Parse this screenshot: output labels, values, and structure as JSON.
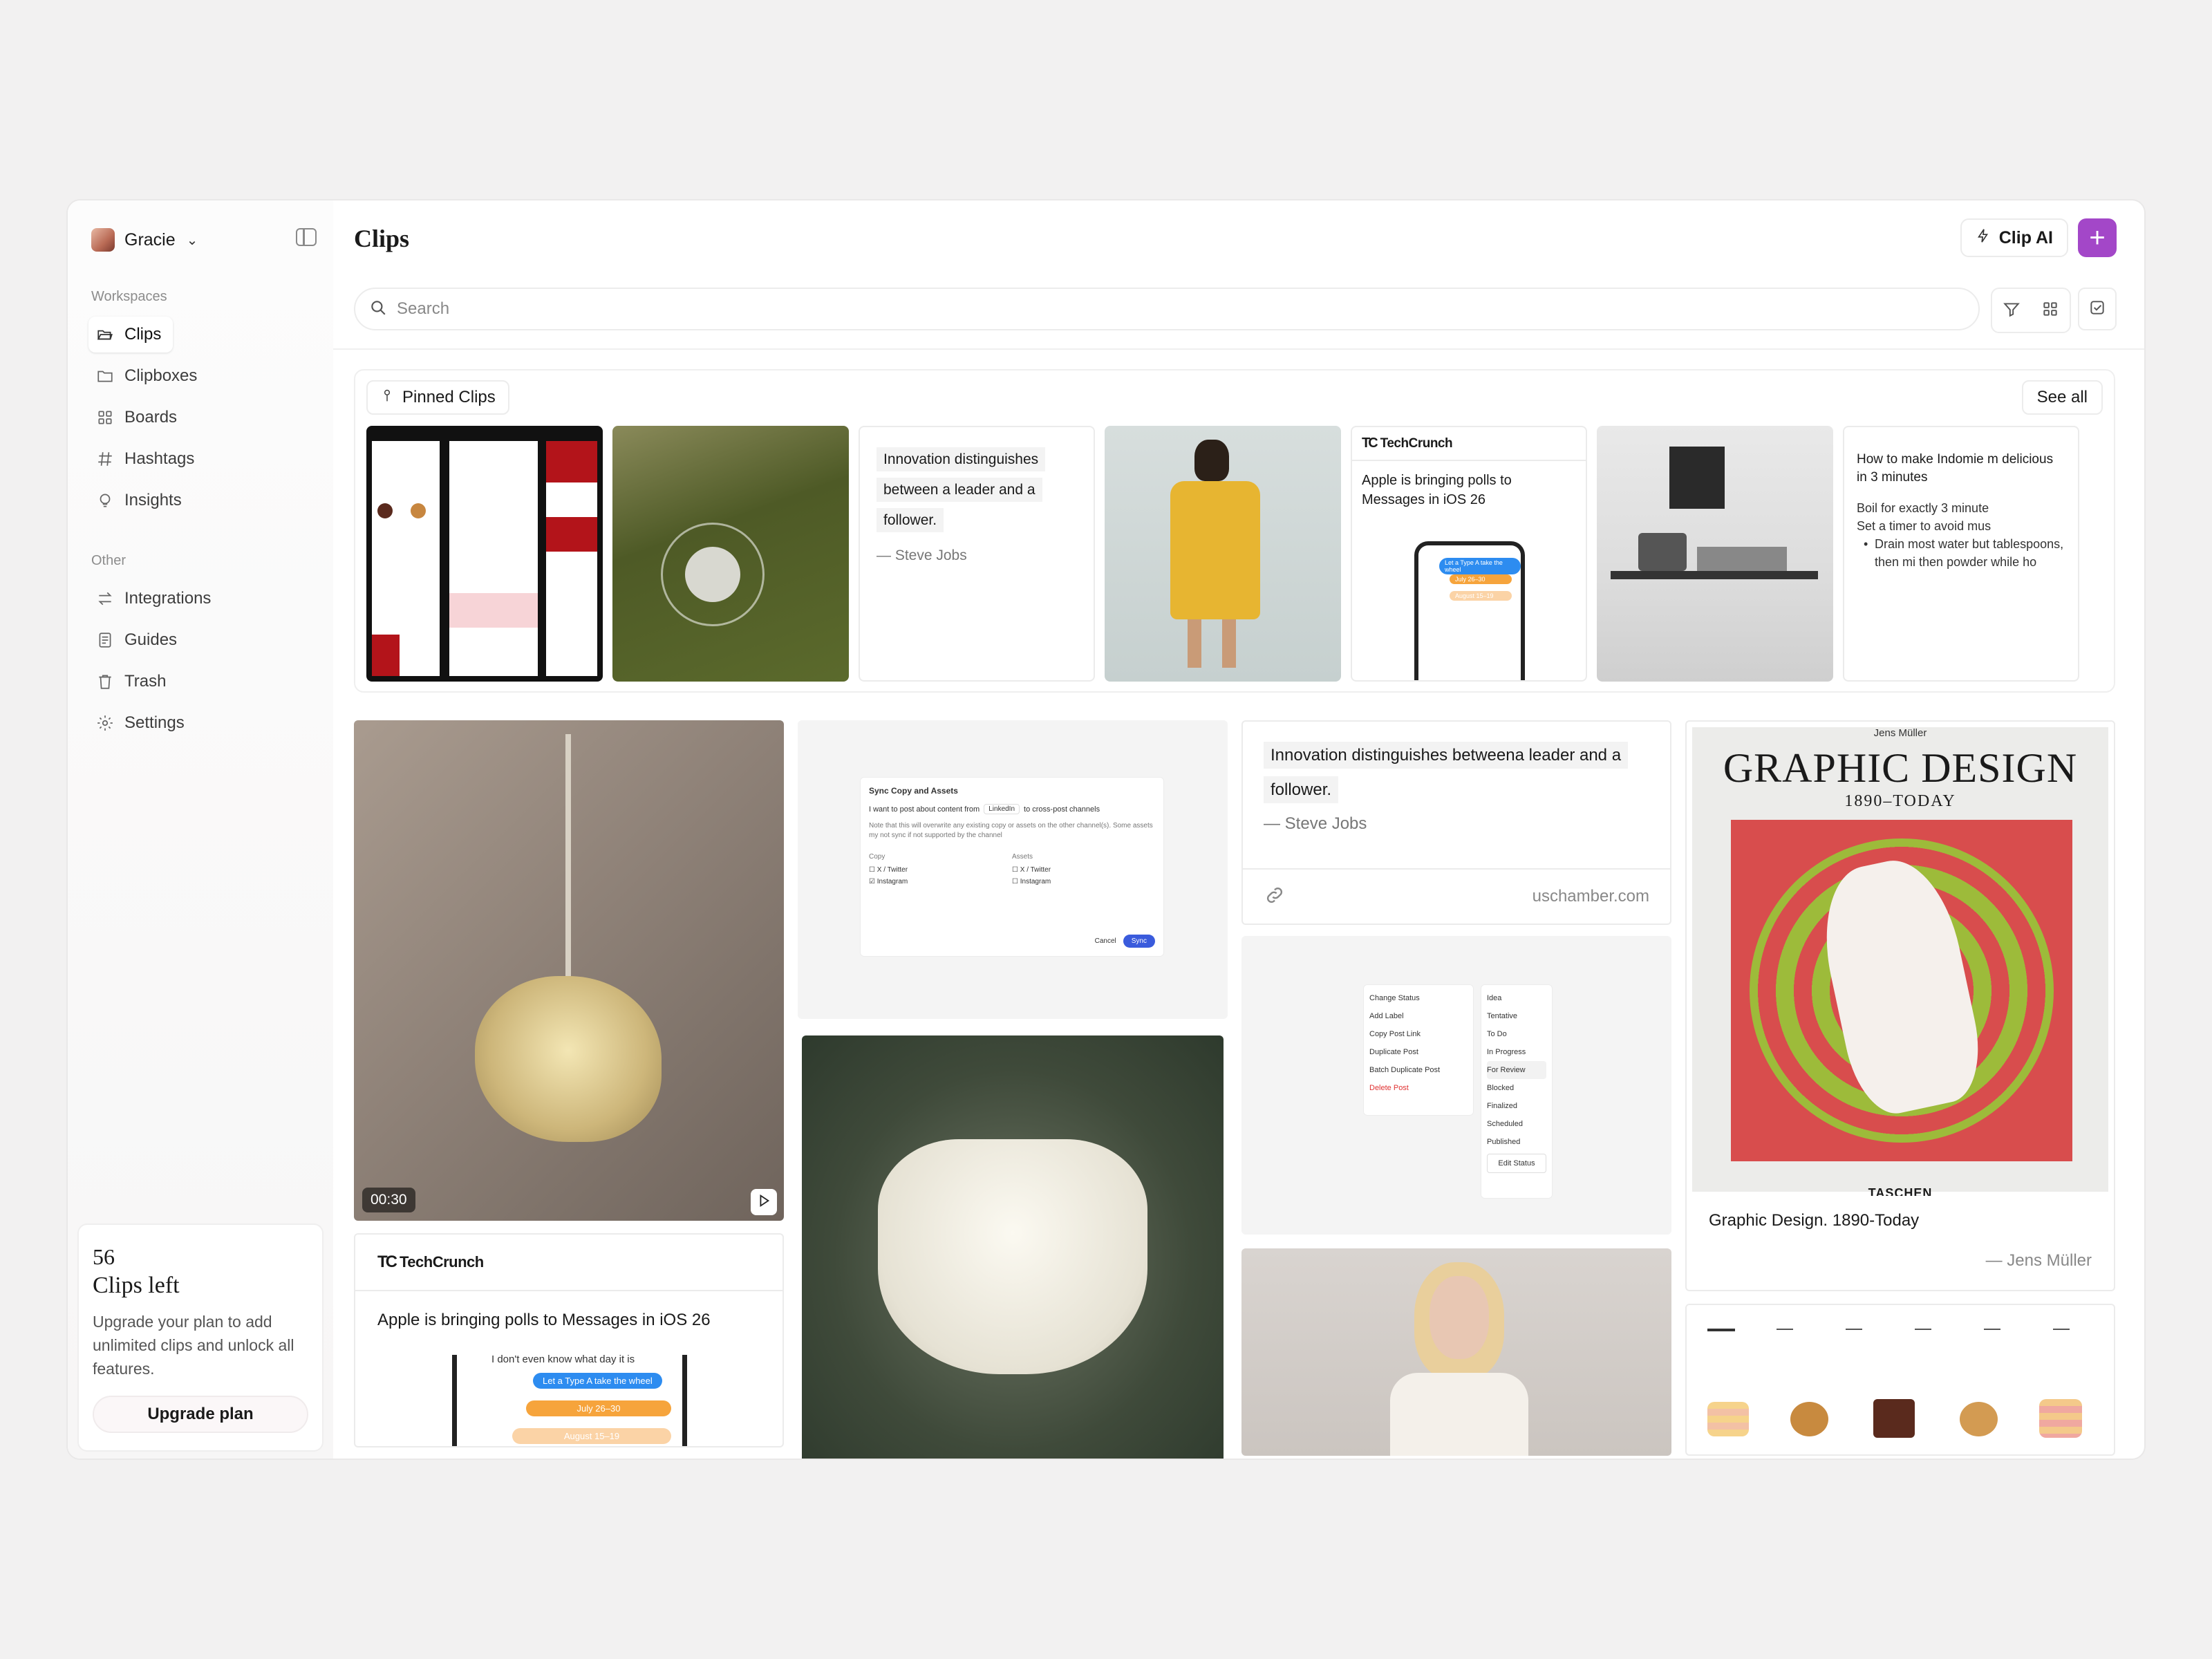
{
  "user": {
    "name": "Gracie"
  },
  "sidebar": {
    "workspaces_label": "Workspaces",
    "workspaces": [
      {
        "label": "Clips",
        "icon": "folder-open-icon",
        "active": true
      },
      {
        "label": "Clipboxes",
        "icon": "folder-icon"
      },
      {
        "label": "Boards",
        "icon": "grid-icon"
      },
      {
        "label": "Hashtags",
        "icon": "hash-icon"
      },
      {
        "label": "Insights",
        "icon": "lightbulb-icon"
      }
    ],
    "other_label": "Other",
    "other": [
      {
        "label": "Integrations",
        "icon": "arrows-icon"
      },
      {
        "label": "Guides",
        "icon": "document-icon"
      },
      {
        "label": "Trash",
        "icon": "trash-icon"
      },
      {
        "label": "Settings",
        "icon": "gear-icon"
      }
    ]
  },
  "promo": {
    "count": "56",
    "title": "Clips left",
    "description": "Upgrade your plan to add unlimited clips and unlock all features.",
    "button": "Upgrade plan"
  },
  "header": {
    "title": "Clips",
    "clip_ai": "Clip AI",
    "add": "+"
  },
  "search": {
    "placeholder": "Search"
  },
  "pinned": {
    "label": "Pinned Clips",
    "see_all": "See all",
    "quote": {
      "text": "Innovation distinguishes between a leader and a follower.",
      "author": "— Steve Jobs"
    },
    "news": {
      "source": "TechCrunch",
      "headline": "Apple is bringing polls to Messages in iOS 26"
    },
    "recipe": {
      "title": "How to make Indomie m delicious in 3 minutes",
      "line1": "Boil for exactly 3 minute",
      "line2": "Set a timer to avoid mus",
      "bullet": "Drain most water but tablespoons, then mi then powder while ho"
    }
  },
  "grid": {
    "video_time": "00:30",
    "news": {
      "source": "TechCrunch",
      "headline": "Apple is bringing polls to Messages in iOS 26"
    },
    "quote": {
      "text": "Innovation distinguishes betweena leader and a follower.",
      "author": "— Steve Jobs",
      "link": "uschamber.com"
    },
    "sync": {
      "title": "Sync Copy and Assets",
      "line": "I want to post about content from",
      "channel": "LinkedIn",
      "line_end": "to cross-post channels",
      "note": "Note that this will overwrite any existing copy or assets on the other channel(s). Some assets my not sync if not supported by the channel",
      "copy_label": "Copy",
      "assets_label": "Assets",
      "opt1": "X / Twitter",
      "opt2": "Instagram",
      "cancel": "Cancel",
      "sync": "Sync"
    },
    "menu": {
      "left": [
        "Change Status",
        "Add Label",
        "Copy Post Link",
        "Duplicate Post",
        "Batch Duplicate Post",
        "Delete Post"
      ],
      "right": [
        "Idea",
        "Tentative",
        "To Do",
        "In Progress",
        "For Review",
        "Blocked",
        "Finalized",
        "Scheduled",
        "Published"
      ],
      "edit": "Edit Status"
    },
    "book": {
      "author_top": "Jens Müller",
      "cover_title": "GRAPHIC DESIGN",
      "cover_sub": "1890–TODAY",
      "publisher": "TASCHEN",
      "caption": "Graphic Design. 1890-Today",
      "author": "— Jens Müller"
    },
    "messages": {
      "m1": "I don't even know what day it is",
      "m2": "Let a Type A take the wheel",
      "m3": "July 26–30",
      "m4": "August 15–19"
    }
  },
  "colors": {
    "accent": "#a347c8",
    "imessage": "#2d8cf0",
    "poll": "#f6a43c"
  }
}
